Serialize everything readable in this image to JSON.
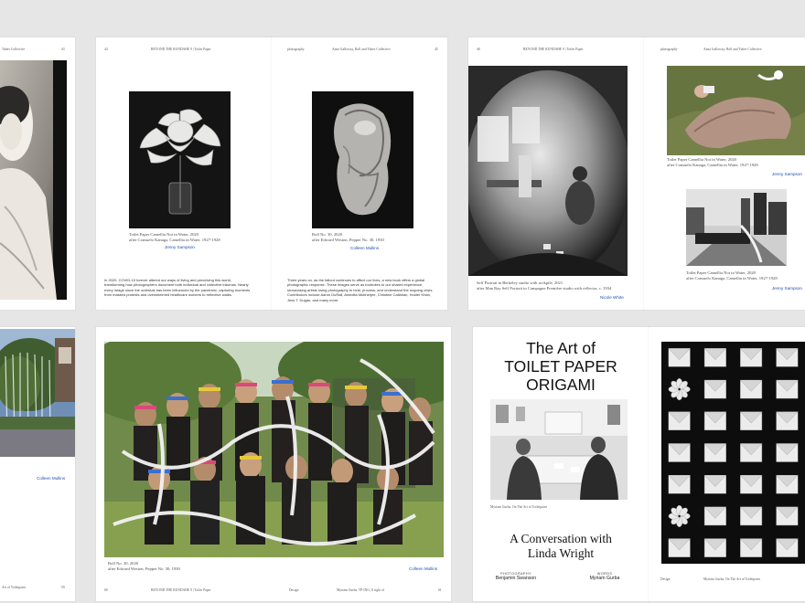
{
  "colors": {
    "background": "#e6e6e6",
    "page": "#ffffff",
    "credit_blue": "#1f4fae"
  },
  "spread1": {
    "left_page": {
      "header_right": "Tubes Collective",
      "page_number": "43"
    }
  },
  "spread2": {
    "left_page": {
      "page_number": "44",
      "running_title": "BEYOND THE RUNDAHE 9 | Toilet Paper",
      "caption_line1": "Toilet Paper Camellia Not in Water, 2020",
      "caption_line2": "after Consuelo Kanaga, Camellia in Water, 1927-1928",
      "credit": "Jenny Sampson",
      "body": "In 2020, COVID-19 forever altered our ways of living and perceiving this world, transforming how photographers document both individual and collective traumas. Nearly every image since the outbreak has been influenced by the pandemic, capturing moments from masked protests and overwhelmed healthcare workers to reflective walks."
    },
    "right_page": {
      "section": "photography",
      "running_title": "Anna Galloway, Roll and Tubes Collective",
      "page_number": "45",
      "caption_line1": "Roll No. 30, 2020",
      "caption_line2": "after Edward Weston, Pepper No. 30, 1930",
      "credit": "Colleen Mullins",
      "body": "Three years on, as the fallout continues to affect our lives, a new book offers a global photographic response. These images serve as footnotes to our shared experience, showcasing artists using photography to heal, process, and understand the ongoing crisis. Contributors include Aaron DuRall, Anindita Mukherjee, Christine Callahan, Holder Khan, Jess T. Dugan, and many more."
    }
  },
  "spread3": {
    "left_page": {
      "page_number": "46",
      "running_title": "BEYOND THE RUNDAHE 9 | Toilet Paper",
      "caption_line1": "Self Portrait in Berkeley studio with rockpile, 2021",
      "caption_line2": "after Man Ray Self Portrait in Campagne Première studio with reflector, c. 1934",
      "credit": "Nicole White"
    },
    "right_page": {
      "section": "photography",
      "running_title": "Anna Galloway, Roll and Tubes Collective",
      "caption1_line1": "Toilet Paper Camellia Not in Water, 2020",
      "caption1_line2": "after Consuelo Kanaga, Camellia in Water, 1927-1928",
      "credit1": "Jenny Sampson",
      "caption2_line1": "Toilet Paper Camellia Not in Water, 2020",
      "caption2_line2": "after Consuelo Kanaga, Camellia in Water, 1927-1928",
      "credit2": "Jenny Sampson"
    }
  },
  "spread4": {
    "left_page": {
      "credit": "Colleen Mullins",
      "footer_left": "Art of Toiletpaint",
      "page_number": "59"
    }
  },
  "spread5": {
    "caption_line1": "Roll No. 30, 2020",
    "caption_line2": "after Edward Weston, Pepper No. 30, 1930",
    "credit": "Colleen Mullins",
    "footer_page_left": "60",
    "footer_running": "BEYOND THE RUNDAHE 9 | Toilet Paper",
    "footer_section": "Design",
    "footer_right_text": "Myriam Gurba, TP-ING, A right of",
    "footer_page_right": "61"
  },
  "spread6": {
    "title_line1": "The Art of",
    "title_line2": "TOILET PAPER",
    "title_line3": "ORIGAMI",
    "photo_caption": "Myriam Gurba, On The Art of Toiletpaint",
    "conversation_line1": "A Conversation with",
    "conversation_line2": "Linda Wright",
    "photography_label": "PHOTOGRAPHY",
    "photography_name": "Benjamin Swanson",
    "words_label": "WORDS",
    "words_name": "Myriam Gurba",
    "footer_section": "Design",
    "footer_right_text": "Myriam Gurba, On The Art of Toiletpaint"
  }
}
